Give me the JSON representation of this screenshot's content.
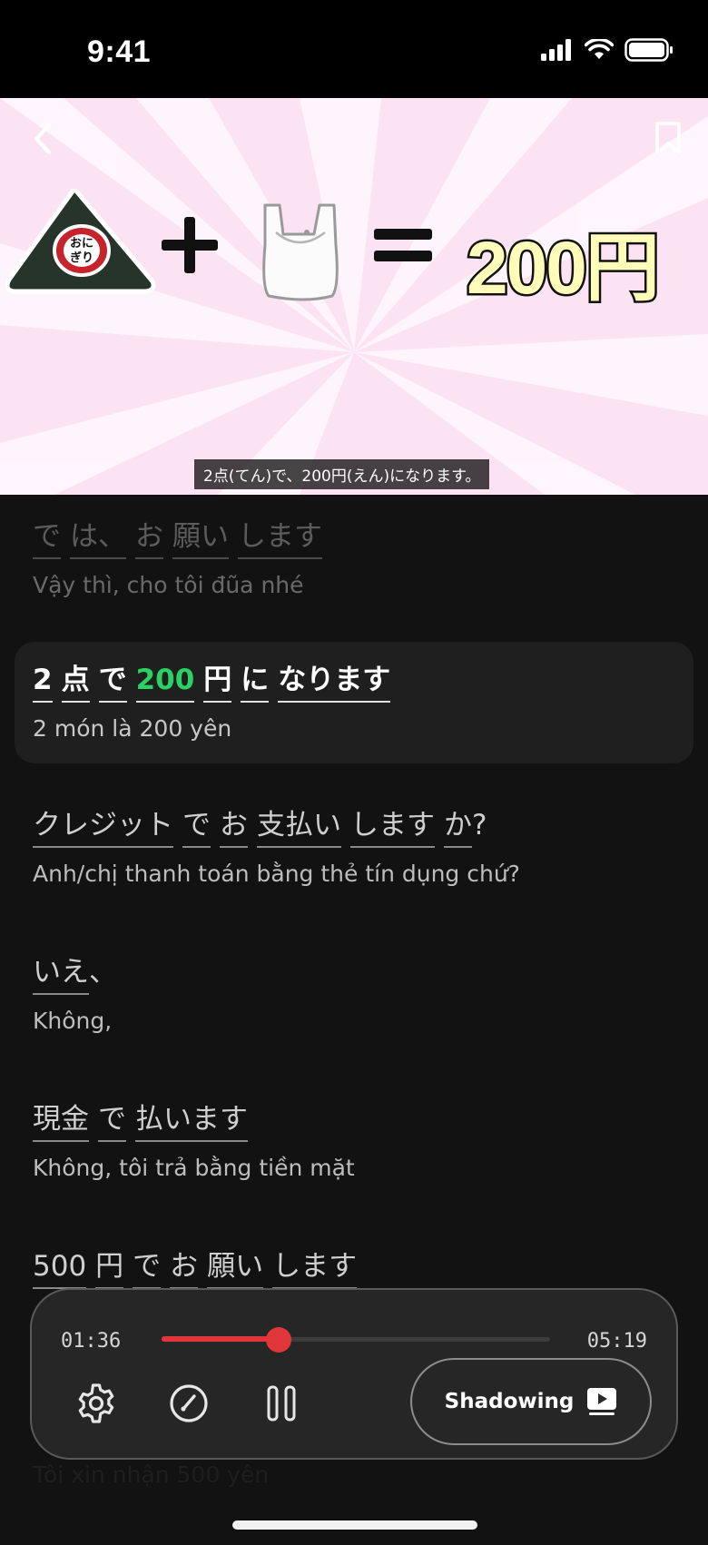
{
  "status_bar": {
    "time": "9:41"
  },
  "video": {
    "price_text": "200円",
    "caption": "2点(てん)で、200円(えん)になります。",
    "onigiri_label": "おにぎり"
  },
  "transcript": [
    {
      "state": "faded",
      "words": [
        "で",
        "は、",
        "お",
        "願い",
        "します"
      ],
      "translation": "Vậy thì, cho tôi đũa nhé"
    },
    {
      "state": "active",
      "words": [
        "2",
        "点",
        "で",
        "200",
        "円",
        "に",
        "なります"
      ],
      "highlight_index": 3,
      "translation": "2 món là 200 yên"
    },
    {
      "state": "normal",
      "words": [
        "クレジット",
        "で",
        "お",
        "支払い",
        "します",
        "か",
        "?"
      ],
      "translation": "Anh/chị thanh toán bằng thẻ tín dụng chứ?"
    },
    {
      "state": "normal",
      "words": [
        "いえ",
        "、"
      ],
      "translation": "Không,"
    },
    {
      "state": "normal",
      "words": [
        "現金",
        "で",
        "払います"
      ],
      "translation": "Không, tôi trả bằng tiền mặt"
    },
    {
      "state": "normal",
      "words": [
        "500",
        "円",
        "で",
        "お",
        "願い",
        "します"
      ],
      "translation": "Tôi xin nhận 500 yên"
    }
  ],
  "player": {
    "current_time": "01:36",
    "total_time": "05:19",
    "progress": 0.301,
    "shadowing_label": "Shadowing",
    "accent_color": "#e0363a"
  },
  "icons": {
    "back": "chevron-left-icon",
    "bookmark": "bookmark-icon",
    "settings": "gear-icon",
    "speed": "speedometer-icon",
    "pause": "pause-icon",
    "shadowing": "play-video-icon"
  },
  "colors": {
    "highlight": "#2bd162",
    "background": "#121212"
  }
}
